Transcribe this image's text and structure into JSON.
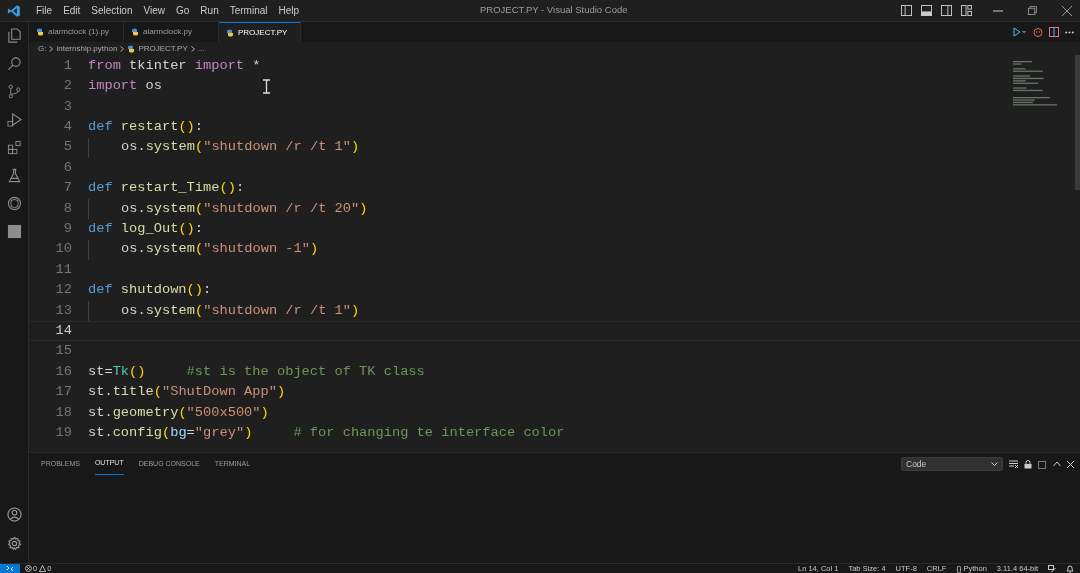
{
  "window": {
    "title": "PROJECT.PY - Visual Studio Code"
  },
  "menu": [
    "File",
    "Edit",
    "Selection",
    "View",
    "Go",
    "Run",
    "Terminal",
    "Help"
  ],
  "activity_bar": [
    {
      "kind": "files",
      "selected": false
    },
    {
      "kind": "search",
      "selected": false
    },
    {
      "kind": "source-control",
      "selected": false
    },
    {
      "kind": "run",
      "selected": false
    },
    {
      "kind": "extensions",
      "selected": false
    },
    {
      "kind": "testing",
      "selected": false
    },
    {
      "kind": "ai",
      "selected": false
    },
    {
      "kind": "square",
      "selected": false
    }
  ],
  "tabs": [
    {
      "label": "alarmclock (1).py",
      "selected": false
    },
    {
      "label": "alarmclock.py",
      "selected": false
    },
    {
      "label": "PROJECT.PY",
      "selected": true
    }
  ],
  "breadcrumb": [
    "G:",
    "internship.python",
    "PROJECT.PY",
    "..."
  ],
  "editor": {
    "lines": [
      {
        "n": "1",
        "current": false,
        "t": [
          {
            "kind": "kw",
            "text": "from"
          },
          {
            "kind": "p",
            "text": " tkinter "
          },
          {
            "kind": "kw",
            "text": "import"
          },
          {
            "kind": "p",
            "text": " *"
          }
        ]
      },
      {
        "n": "2",
        "current": false,
        "t": [
          {
            "kind": "kw",
            "text": "import"
          },
          {
            "kind": "p",
            "text": " os"
          }
        ]
      },
      {
        "n": "3",
        "current": false
      },
      {
        "n": "4",
        "current": false,
        "t": [
          {
            "kind": "def",
            "text": "def"
          },
          {
            "kind": "fn",
            "text": " restart"
          },
          {
            "kind": "b",
            "text": "()"
          },
          {
            "kind": "p",
            "text": ":"
          }
        ]
      },
      {
        "n": "5",
        "current": false,
        "indented": true,
        "t": [
          {
            "kind": "p",
            "text": "os."
          },
          {
            "kind": "fn",
            "text": "system"
          },
          {
            "kind": "b",
            "text": "("
          },
          {
            "kind": "s",
            "text": "\"shutdown /r /t 1\""
          },
          {
            "kind": "b",
            "text": ")"
          }
        ]
      },
      {
        "n": "6",
        "current": false
      },
      {
        "n": "7",
        "current": false,
        "t": [
          {
            "kind": "def",
            "text": "def"
          },
          {
            "kind": "fn",
            "text": " restart_Time"
          },
          {
            "kind": "b",
            "text": "()"
          },
          {
            "kind": "p",
            "text": ":"
          }
        ]
      },
      {
        "n": "8",
        "current": false,
        "indented": true,
        "t": [
          {
            "kind": "p",
            "text": "os."
          },
          {
            "kind": "fn",
            "text": "system"
          },
          {
            "kind": "b",
            "text": "("
          },
          {
            "kind": "s",
            "text": "\"shutdown /r /t 20\""
          },
          {
            "kind": "b",
            "text": ")"
          }
        ]
      },
      {
        "n": "9",
        "current": false,
        "t": [
          {
            "kind": "def",
            "text": "def"
          },
          {
            "kind": "fn",
            "text": " log_Out"
          },
          {
            "kind": "b",
            "text": "()"
          },
          {
            "kind": "p",
            "text": ":"
          }
        ]
      },
      {
        "n": "10",
        "current": false,
        "indented": true,
        "t": [
          {
            "kind": "p",
            "text": "os."
          },
          {
            "kind": "fn",
            "text": "system"
          },
          {
            "kind": "b",
            "text": "("
          },
          {
            "kind": "s",
            "text": "\"shutdown -1\""
          },
          {
            "kind": "b",
            "text": ")"
          }
        ]
      },
      {
        "n": "11",
        "current": false
      },
      {
        "n": "12",
        "current": false,
        "t": [
          {
            "kind": "def",
            "text": "def"
          },
          {
            "kind": "fn",
            "text": " shutdown"
          },
          {
            "kind": "b",
            "text": "()"
          },
          {
            "kind": "p",
            "text": ":"
          }
        ]
      },
      {
        "n": "13",
        "current": false,
        "indented": true,
        "t": [
          {
            "kind": "p",
            "text": "os."
          },
          {
            "kind": "fn",
            "text": "system"
          },
          {
            "kind": "b",
            "text": "("
          },
          {
            "kind": "s",
            "text": "\"shutdown /r /t 1\""
          },
          {
            "kind": "b",
            "text": ")"
          }
        ]
      },
      {
        "n": "14",
        "current": true
      },
      {
        "n": "15",
        "current": false
      },
      {
        "n": "16",
        "current": false,
        "t": [
          {
            "kind": "p",
            "text": "st="
          },
          {
            "kind": "cls",
            "text": "Tk"
          },
          {
            "kind": "b",
            "text": "()"
          },
          {
            "kind": "c",
            "text": "     #st is the object of TK class"
          }
        ]
      },
      {
        "n": "17",
        "current": false,
        "t": [
          {
            "kind": "p",
            "text": "st."
          },
          {
            "kind": "fn",
            "text": "title"
          },
          {
            "kind": "b",
            "text": "("
          },
          {
            "kind": "s",
            "text": "\"ShutDown App\""
          },
          {
            "kind": "b",
            "text": ")"
          }
        ]
      },
      {
        "n": "18",
        "current": false,
        "t": [
          {
            "kind": "p",
            "text": "st."
          },
          {
            "kind": "fn",
            "text": "geometry"
          },
          {
            "kind": "b",
            "text": "("
          },
          {
            "kind": "s",
            "text": "\"500x500\""
          },
          {
            "kind": "b",
            "text": ")"
          }
        ]
      },
      {
        "n": "19",
        "current": false,
        "t": [
          {
            "kind": "p",
            "text": "st."
          },
          {
            "kind": "fn",
            "text": "config"
          },
          {
            "kind": "b",
            "text": "("
          },
          {
            "kind": "v",
            "text": "bg"
          },
          {
            "kind": "p",
            "text": "="
          },
          {
            "kind": "s",
            "text": "\"grey\""
          },
          {
            "kind": "b",
            "text": ")"
          },
          {
            "kind": "c",
            "text": "     # for changing te interface color"
          }
        ]
      }
    ]
  },
  "panel": {
    "tabs": [
      {
        "label": "PROBLEMS",
        "selected": false
      },
      {
        "label": "OUTPUT",
        "selected": true
      },
      {
        "label": "DEBUG CONSOLE",
        "selected": false
      },
      {
        "label": "TERMINAL",
        "selected": false
      }
    ],
    "channel": "Code"
  },
  "status_bar": {
    "errors": "0",
    "warnings": "0",
    "right": [
      "Ln 14, Col 1",
      "Tab Size: 4",
      "UTF-8",
      "CRLF",
      "{} Python",
      "3.11.4 64-bit"
    ]
  }
}
